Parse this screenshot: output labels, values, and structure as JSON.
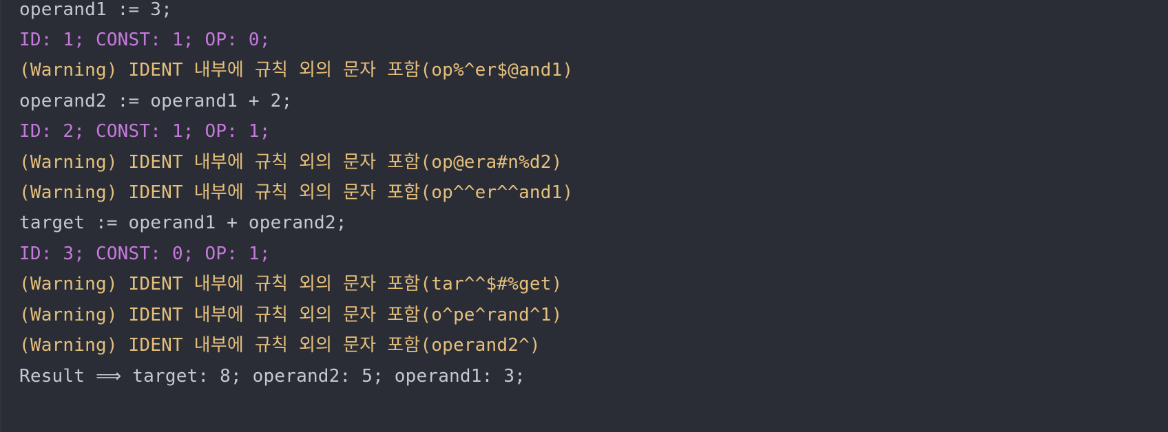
{
  "console": {
    "lines": [
      {
        "text": "operand1 := 3;",
        "kind": "code"
      },
      {
        "text": "ID: 1; CONST: 1; OP: 0;",
        "kind": "stat"
      },
      {
        "text": "(Warning) IDENT 내부에 규칙 외의 문자 포함(op%^er$@and1)",
        "kind": "warn"
      },
      {
        "text": "operand2 := operand1 + 2;",
        "kind": "code"
      },
      {
        "text": "ID: 2; CONST: 1; OP: 1;",
        "kind": "stat"
      },
      {
        "text": "(Warning) IDENT 내부에 규칙 외의 문자 포함(op@era#n%d2)",
        "kind": "warn"
      },
      {
        "text": "(Warning) IDENT 내부에 규칙 외의 문자 포함(op^^er^^and1)",
        "kind": "warn"
      },
      {
        "text": "target := operand1 + operand2;",
        "kind": "code"
      },
      {
        "text": "ID: 3; CONST: 0; OP: 1;",
        "kind": "stat"
      },
      {
        "text": "(Warning) IDENT 내부에 규칙 외의 문자 포함(tar^^$#%get)",
        "kind": "warn"
      },
      {
        "text": "(Warning) IDENT 내부에 규칙 외의 문자 포함(o^pe^rand^1)",
        "kind": "warn"
      },
      {
        "text": "(Warning) IDENT 내부에 규칙 외의 문자 포함(operand2^)",
        "kind": "warn"
      },
      {
        "text": "Result ⟹ target: 8; operand2: 5; operand1: 3;",
        "kind": "result"
      }
    ]
  },
  "colors": {
    "background": "#2b2d36",
    "code": "#c6c8ce",
    "stat": "#c679dd",
    "warning": "#e5c07b"
  }
}
